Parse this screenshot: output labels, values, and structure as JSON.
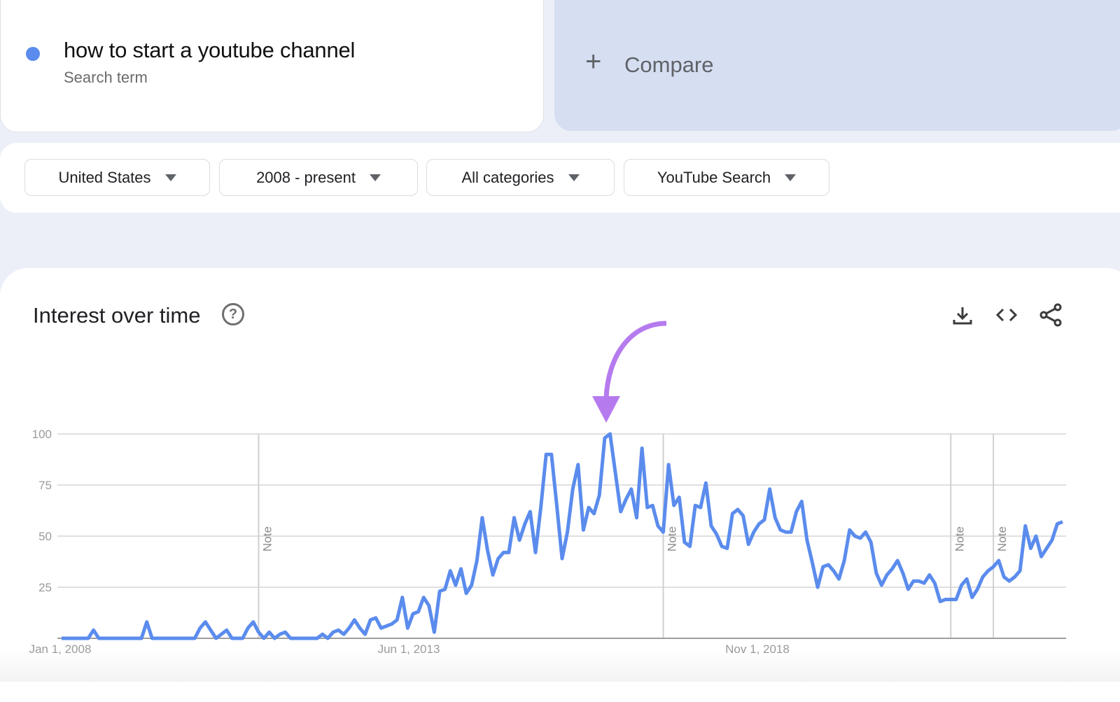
{
  "search_term": {
    "label": "how to start a youtube channel",
    "sublabel": "Search term",
    "color": "#5b8ced"
  },
  "compare": {
    "icon": "plus-icon",
    "label": "Compare"
  },
  "filters": [
    {
      "label": "United States",
      "icon": "caret-down-icon"
    },
    {
      "label": "2008 - present",
      "icon": "caret-down-icon"
    },
    {
      "label": "All categories",
      "icon": "caret-down-icon"
    },
    {
      "label": "YouTube Search",
      "icon": "caret-down-icon"
    }
  ],
  "panel": {
    "title": "Interest over time",
    "help_icon": "help-circle-icon",
    "actions": [
      {
        "name": "download",
        "icon": "download-icon"
      },
      {
        "name": "embed",
        "icon": "code-icon"
      },
      {
        "name": "share",
        "icon": "share-icon"
      }
    ]
  },
  "annotation": {
    "type": "arrow",
    "color": "#b57bee",
    "points_to": "peak"
  },
  "chart_data": {
    "type": "line",
    "title": "Interest over time",
    "xlabel": "",
    "ylabel": "",
    "ylim": [
      0,
      100
    ],
    "yticks": [
      25,
      50,
      75,
      100
    ],
    "xtick_labels": [
      "Jan 1, 2008",
      "Jun 1, 2013",
      "Nov 1, 2018"
    ],
    "x_range": [
      "2008-01",
      "2024-05"
    ],
    "grid": true,
    "notes": [
      {
        "label": "Note",
        "at_index": 37
      },
      {
        "label": "Note",
        "at_index": 113
      },
      {
        "label": "Note",
        "at_index": 167
      },
      {
        "label": "Note",
        "at_index": 175
      }
    ],
    "series": [
      {
        "name": "how to start a youtube channel",
        "color": "#5b8ced",
        "values": [
          0,
          0,
          0,
          0,
          0,
          0,
          4,
          0,
          0,
          0,
          0,
          0,
          0,
          0,
          0,
          0,
          8,
          0,
          0,
          0,
          0,
          0,
          0,
          0,
          0,
          0,
          5,
          8,
          4,
          0,
          2,
          4,
          0,
          0,
          0,
          5,
          8,
          3,
          0,
          3,
          0,
          2,
          3,
          0,
          0,
          0,
          0,
          0,
          0,
          2,
          0,
          3,
          4,
          2,
          5,
          9,
          5,
          2,
          9,
          10,
          5,
          6,
          7,
          9,
          20,
          5,
          12,
          13,
          20,
          16,
          3,
          23,
          24,
          33,
          26,
          34,
          22,
          26,
          38,
          59,
          43,
          31,
          39,
          42,
          42,
          59,
          48,
          56,
          62,
          42,
          64,
          90,
          90,
          65,
          39,
          52,
          73,
          85,
          53,
          64,
          61,
          70,
          98,
          100,
          81,
          62,
          68,
          73,
          59,
          93,
          64,
          65,
          55,
          52,
          85,
          65,
          69,
          47,
          45,
          65,
          64,
          76,
          55,
          51,
          45,
          44,
          61,
          63,
          60,
          46,
          52,
          56,
          58,
          73,
          59,
          53,
          52,
          52,
          62,
          67,
          48,
          37,
          25,
          35,
          36,
          33,
          29,
          38,
          53,
          50,
          49,
          52,
          47,
          32,
          26,
          31,
          34,
          38,
          32,
          24,
          28,
          28,
          27,
          31,
          27,
          18,
          19,
          19,
          19,
          26,
          29,
          20,
          24,
          30,
          33,
          35,
          38,
          30,
          28,
          30,
          33,
          55,
          44,
          50,
          40,
          44,
          48,
          56,
          57
        ]
      }
    ]
  }
}
